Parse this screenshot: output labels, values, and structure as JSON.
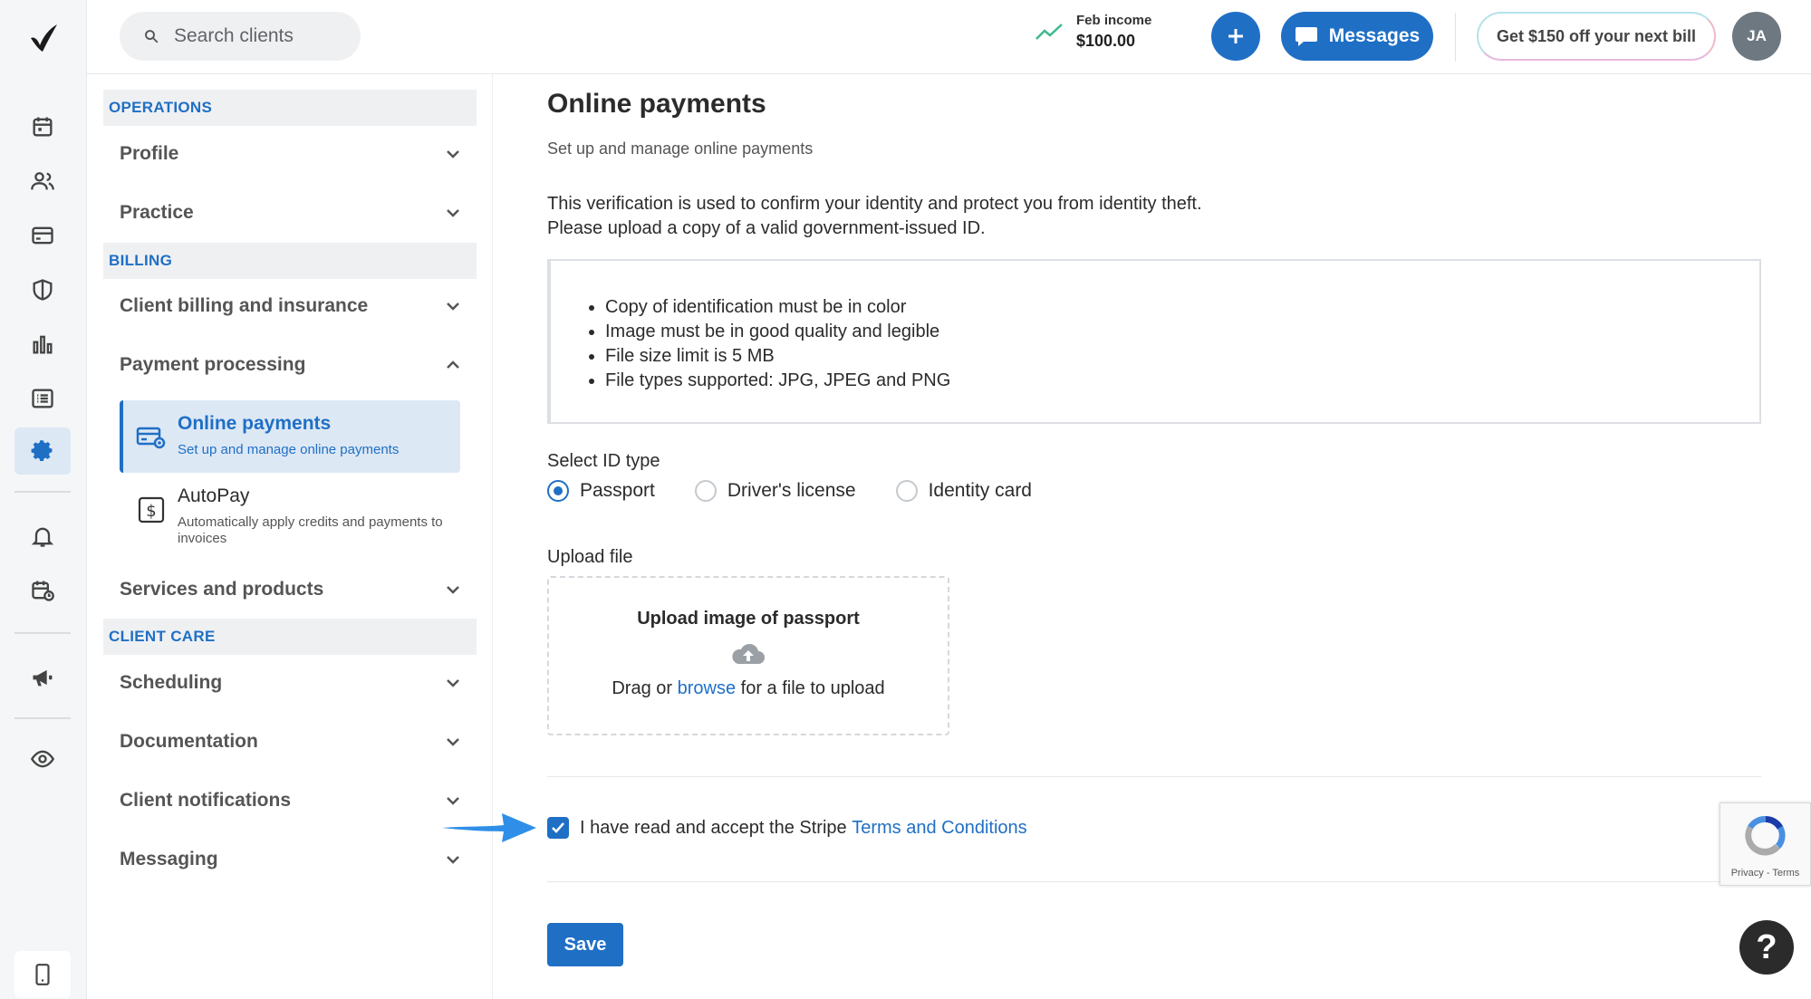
{
  "topbar": {
    "search_placeholder": "Search clients",
    "income_label": "Feb income",
    "income_value": "$100.00",
    "messages_label": "Messages",
    "promo_label": "Get $150 off your next bill",
    "avatar_initials": "JA"
  },
  "settings_nav": {
    "operations_header": "OPERATIONS",
    "profile": "Profile",
    "practice": "Practice",
    "billing_header": "BILLING",
    "client_billing": "Client billing and insurance",
    "payment_processing": "Payment processing",
    "online_payments_title": "Online payments",
    "online_payments_desc": "Set up and manage online payments",
    "autopay_title": "AutoPay",
    "autopay_desc": "Automatically apply credits and payments to invoices",
    "services_products": "Services and products",
    "client_care_header": "CLIENT CARE",
    "scheduling": "Scheduling",
    "documentation": "Documentation",
    "client_notifications": "Client notifications",
    "messaging": "Messaging"
  },
  "main": {
    "title": "Online payments",
    "subtitle": "Set up and manage online payments",
    "verification_line1": "This verification is used to confirm your identity and protect you from identity theft.",
    "verification_line2": "Please upload a copy of a valid government-issued ID.",
    "requirements": [
      "Copy of identification must be in color",
      "Image must be in good quality and legible",
      "File size limit is 5 MB",
      "File types supported: JPG, JPEG and PNG"
    ],
    "id_type_label": "Select ID type",
    "id_types": [
      "Passport",
      "Driver's license",
      "Identity card"
    ],
    "selected_id_type": "Passport",
    "upload_label": "Upload file",
    "upload_title": "Upload image of passport",
    "upload_drag": "Drag or",
    "upload_browse": "browse",
    "upload_rest": "for a file to upload",
    "accept_text": "I have read and accept the Stripe",
    "terms_link": "Terms and Conditions",
    "accept_checked": true,
    "save_label": "Save"
  },
  "recaptcha": {
    "text": "Privacy - Terms"
  },
  "help": {
    "label": "?"
  },
  "colors": {
    "accent": "#1f6fc5",
    "income_trend": "#3dba8c",
    "arrow": "#2f8fe8"
  }
}
